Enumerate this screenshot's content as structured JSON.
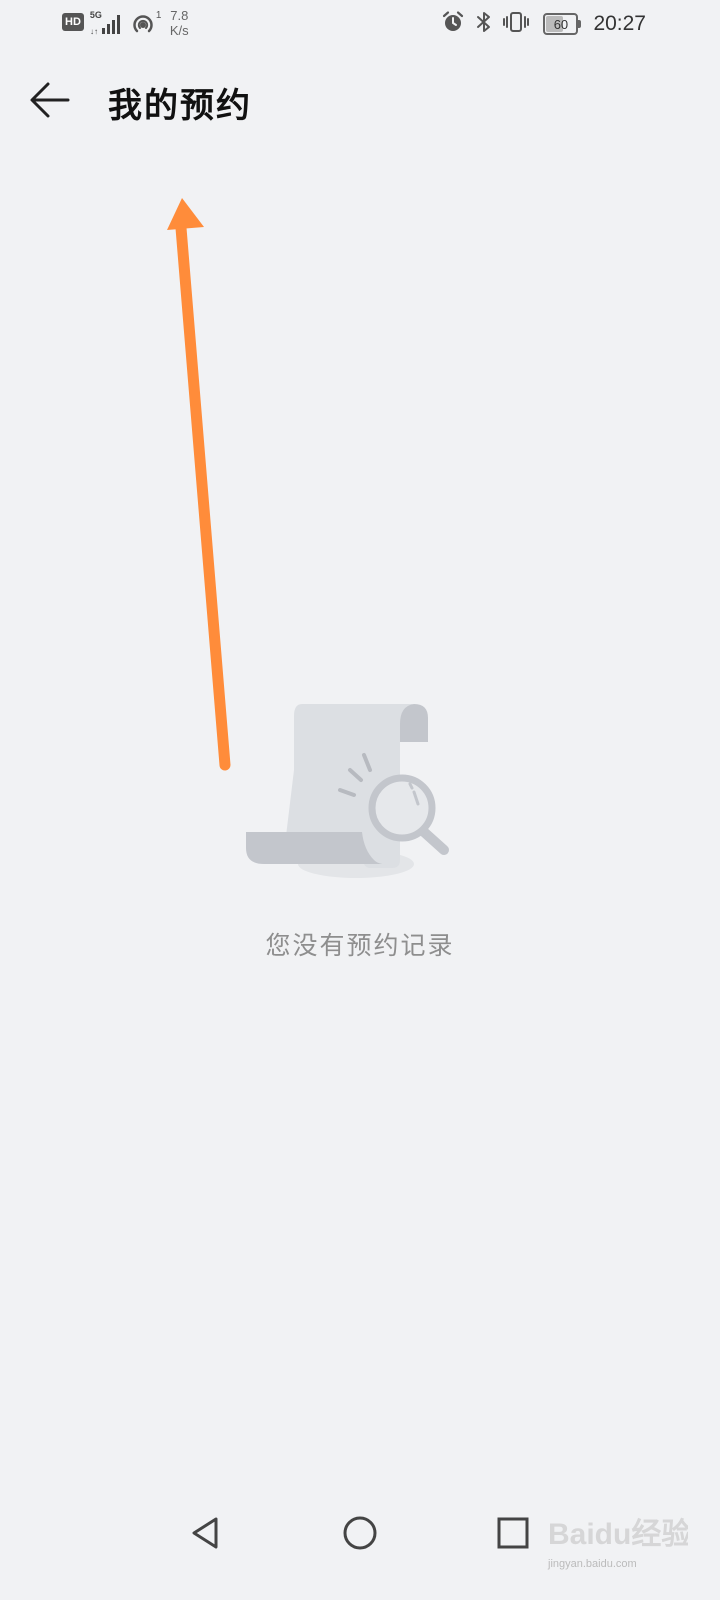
{
  "status_bar": {
    "hd_label": "HD",
    "network_type": "5G",
    "hotspot_count": "1",
    "speed_value": "7.8",
    "speed_unit": "K/s",
    "battery_level": "60",
    "time": "20:27",
    "icons": [
      "hd-icon",
      "signal-icon",
      "hotspot-icon",
      "alarm-icon",
      "bluetooth-icon",
      "vibrate-icon",
      "battery-icon"
    ]
  },
  "header": {
    "title": "我的预约",
    "back_icon": "arrow-left-icon"
  },
  "empty_state": {
    "message": "您没有预约记录",
    "illustration": "document-search-illustration"
  },
  "annotation": {
    "arrow_color": "#ff8c3a"
  },
  "nav_bar": {
    "icons": [
      "nav-back-icon",
      "nav-home-icon",
      "nav-recent-icon"
    ]
  },
  "watermark": {
    "logo_text": "Baidu经验",
    "url": "jingyan.baidu.com"
  },
  "colors": {
    "background": "#f1f2f4",
    "empty_text": "#8e8e8e",
    "illustration_light": "#dcdfe3",
    "illustration_dark": "#c3c6cc"
  }
}
